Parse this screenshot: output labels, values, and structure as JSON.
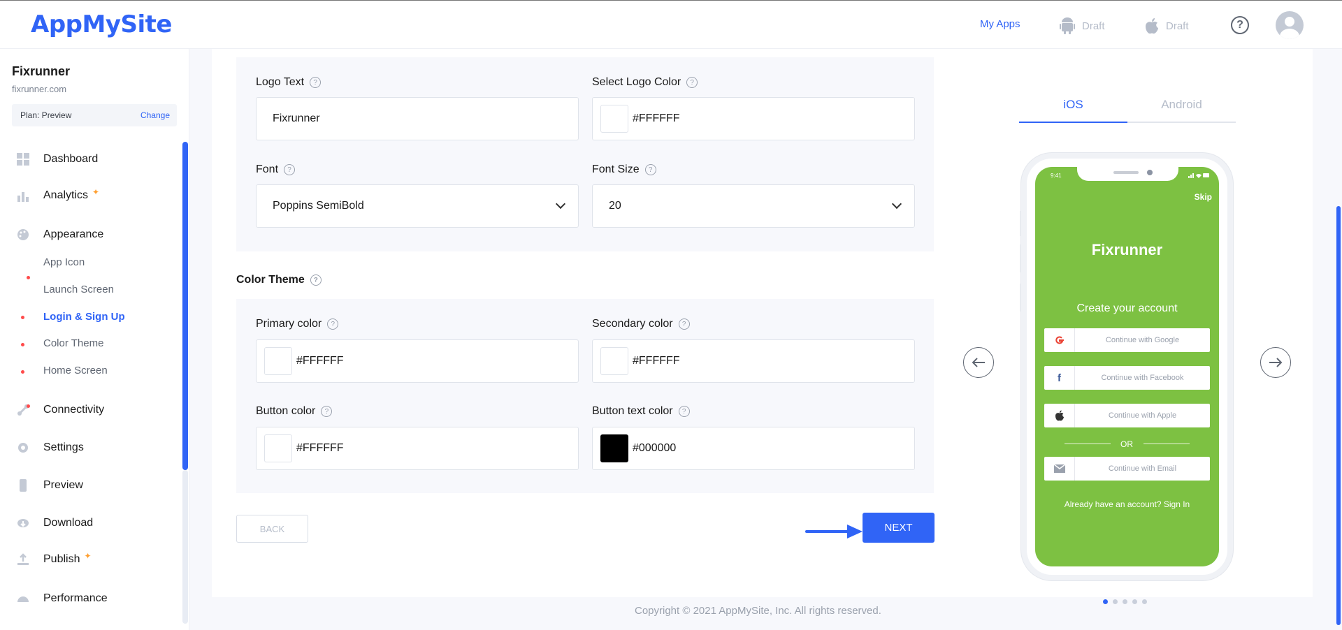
{
  "header": {
    "logo": "AppMySite",
    "my_apps": "My Apps",
    "android_status": "Draft",
    "ios_status": "Draft",
    "help": "?"
  },
  "sidebar": {
    "site_name": "Fixrunner",
    "site_url": "fixrunner.com",
    "plan_label": "Plan: Preview",
    "change_label": "Change",
    "items": [
      {
        "label": "Dashboard"
      },
      {
        "label": "Analytics"
      },
      {
        "label": "Appearance"
      },
      {
        "label": "Connectivity"
      },
      {
        "label": "Settings"
      },
      {
        "label": "Preview"
      },
      {
        "label": "Download"
      },
      {
        "label": "Publish"
      },
      {
        "label": "Performance"
      }
    ],
    "subitems": [
      {
        "label": "App Icon"
      },
      {
        "label": "Launch Screen"
      },
      {
        "label": "Login & Sign Up"
      },
      {
        "label": "Color Theme"
      },
      {
        "label": "Home Screen"
      }
    ]
  },
  "form": {
    "logo_text_label": "Logo Text",
    "logo_text_value": "Fixrunner",
    "logo_color_label": "Select Logo Color",
    "logo_color_value": "#FFFFFF",
    "font_label": "Font",
    "font_value": "Poppins SemiBold",
    "font_size_label": "Font Size",
    "font_size_value": "20",
    "color_theme_title": "Color Theme",
    "primary_label": "Primary color",
    "primary_value": "#FFFFFF",
    "secondary_label": "Secondary color",
    "secondary_value": "#FFFFFF",
    "button_color_label": "Button color",
    "button_color_value": "#FFFFFF",
    "button_text_color_label": "Button text color",
    "button_text_color_value": "#000000",
    "back_label": "BACK",
    "next_label": "NEXT"
  },
  "preview": {
    "tab_ios": "iOS",
    "tab_android": "Android",
    "status_time": "9:41",
    "skip": "Skip",
    "app_name": "Fixrunner",
    "create_account": "Create your account",
    "google": "Continue with Google",
    "facebook": "Continue with Facebook",
    "apple": "Continue with Apple",
    "or": "OR",
    "email": "Continue with Email",
    "already": "Already have an account? Sign In",
    "screen_color": "#7DC142"
  },
  "footer": {
    "copyright": "Copyright © 2021 AppMySite, Inc. All rights reserved."
  },
  "colors": {
    "accent": "#3064F6"
  }
}
